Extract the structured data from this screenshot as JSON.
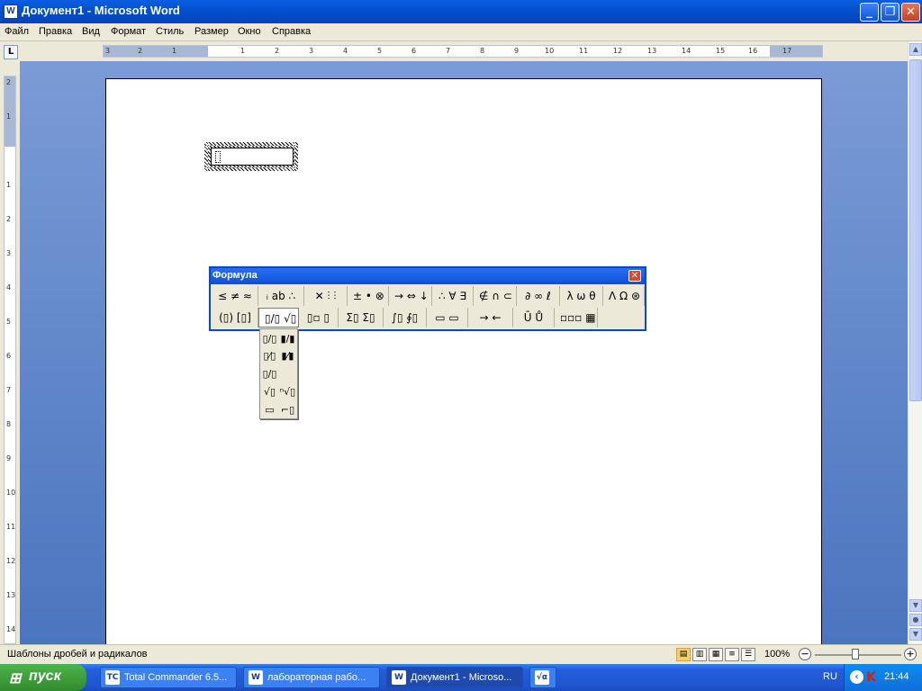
{
  "window": {
    "title": "Документ1 - Microsoft Word",
    "icon": "word-doc-icon",
    "controls": {
      "minimize": "_",
      "maximize": "❐",
      "close": "✕"
    }
  },
  "menu": [
    "Файл",
    "Правка",
    "Вид",
    "Формат",
    "Стиль",
    "Размер",
    "Окно",
    "Справка"
  ],
  "ruler": {
    "horizontal_ticks": [
      "3",
      "2",
      "1",
      "1",
      "2",
      "3",
      "4",
      "5",
      "6",
      "7",
      "8",
      "9",
      "10",
      "11",
      "12",
      "13",
      "14",
      "15",
      "16",
      "17"
    ],
    "vertical_ticks": [
      "2",
      "1",
      "1",
      "2",
      "3",
      "4",
      "5",
      "6",
      "7",
      "8",
      "9",
      "10",
      "11",
      "12",
      "13",
      "14"
    ]
  },
  "formula_toolbar": {
    "title": "Формула",
    "close": "✕",
    "row1": [
      "≤ ≠ ≈",
      "ᵢ ab ∴",
      "✕ ⫶ ⫶",
      "± • ⊗",
      "→ ⇔ ↓",
      "∴ ∀ ∃",
      "∉ ∩ ⊂",
      "∂ ∞ ℓ",
      "λ ω θ",
      "Λ Ω ⊛"
    ],
    "row2": [
      "(▯) [▯]",
      "▯/▯ √▯",
      "▯▫ ▯",
      "Σ▯ Σ▯",
      "∫▯ ∮▯",
      "▭ ▭",
      "→ ←",
      "Ū Ů",
      "▫▫▫ ▦"
    ],
    "palette": [
      "▯/▯",
      "▮/▮",
      "▯⁄▯",
      "▮⁄▮",
      "▯/▯",
      "√▯",
      "ⁿ√▯",
      "▭",
      "⌐▯"
    ]
  },
  "status": {
    "text": "Шаблоны дробей и радикалов",
    "zoom": "100%",
    "zoom_minus": "−",
    "zoom_plus": "+"
  },
  "taskbar": {
    "start_label": "пуск",
    "tasks": [
      {
        "label": "Total Commander 6.5...",
        "icon": "TC"
      },
      {
        "label": "лабораторная рабо...",
        "icon": "W"
      },
      {
        "label": "Документ1 - Microso...",
        "icon": "W"
      },
      {
        "label": "",
        "icon": "√α"
      }
    ],
    "language": "RU",
    "time": "21:44"
  },
  "colors": {
    "titlebar": "#0550d0",
    "taskbar": "#245edb",
    "start": "#318b2e",
    "document_background": "#5d84c8"
  }
}
